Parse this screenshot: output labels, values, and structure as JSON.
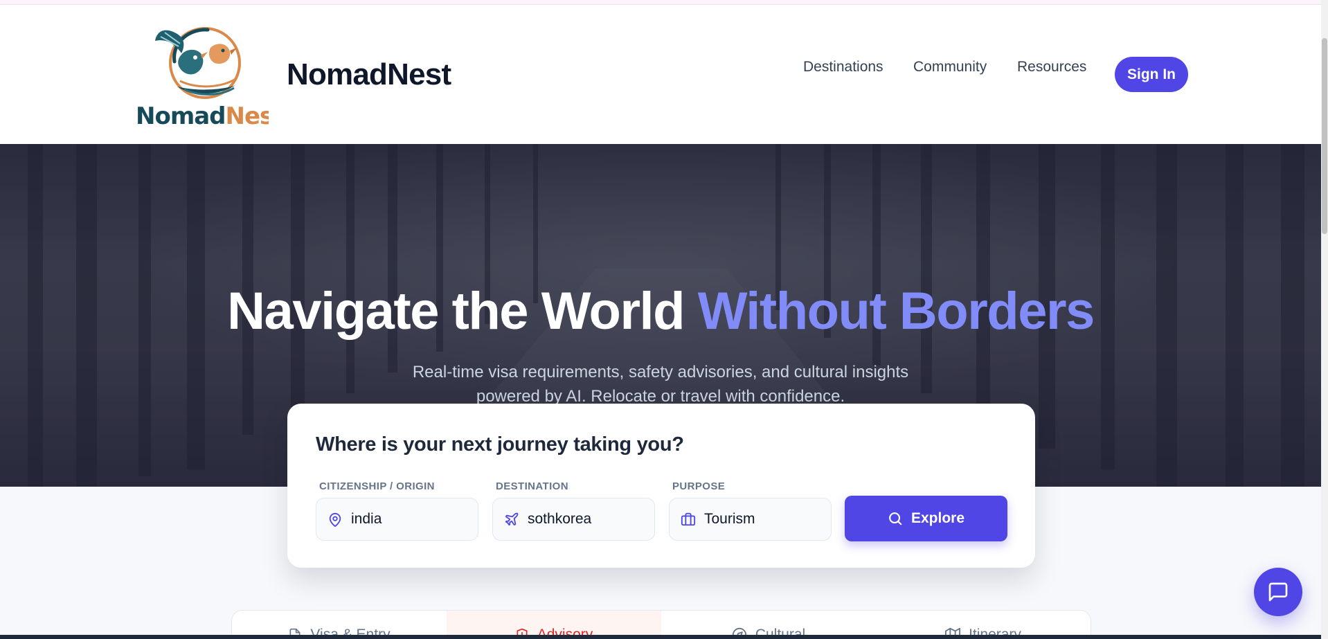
{
  "header": {
    "logo_text": "NomadNest",
    "brand": "NomadNest",
    "nav": [
      "Destinations",
      "Community",
      "Resources"
    ],
    "sign_in": "Sign In"
  },
  "hero": {
    "title_main": "Navigate the World",
    "title_accent": "Without Borders",
    "subtitle_line1": "Real-time visa requirements, safety advisories, and cultural insights",
    "subtitle_line2": "powered by AI. Relocate or travel with confidence."
  },
  "search": {
    "title": "Where is your next journey taking you?",
    "origin": {
      "label": "Citizenship / Origin",
      "value": "india",
      "icon": "map-pin-icon"
    },
    "destination": {
      "label": "Destination",
      "value": "sothkorea",
      "icon": "plane-icon"
    },
    "purpose": {
      "label": "Purpose",
      "value": "Tourism",
      "icon": "briefcase-icon"
    },
    "explore": "Explore"
  },
  "tabs": [
    {
      "label": "Visa & Entry",
      "icon": "document-icon",
      "active": false
    },
    {
      "label": "Advisory",
      "icon": "shield-icon",
      "active": true
    },
    {
      "label": "Cultural",
      "icon": "compass-icon",
      "active": false
    },
    {
      "label": "Itinerary",
      "icon": "map-icon",
      "active": false
    }
  ],
  "colors": {
    "primary": "#4f46e5",
    "accent": "#818cf8",
    "advisory": "#dc2626",
    "text_dark": "#0f172a"
  },
  "chat": {
    "icon": "chat-bubble-icon"
  }
}
